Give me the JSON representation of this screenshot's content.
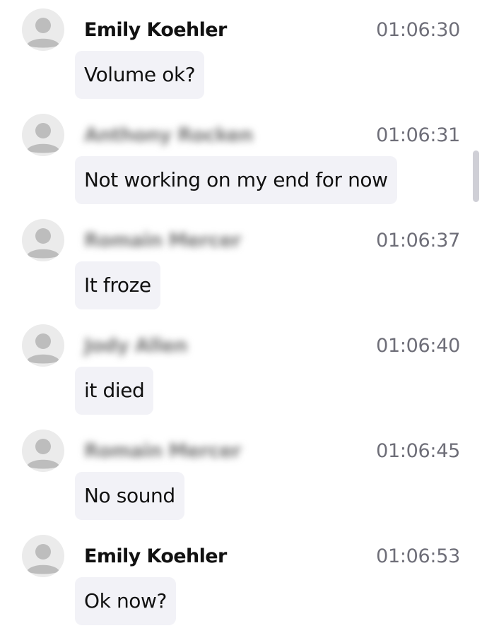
{
  "messages": [
    {
      "sender": "Emily Koehler",
      "time": "01:06:30",
      "text": "Volume ok?",
      "sender_blurred": false
    },
    {
      "sender": "Anthony Rocken",
      "time": "01:06:31",
      "text": "Not working on my end for now",
      "sender_blurred": true
    },
    {
      "sender": "Romain Mercer",
      "time": "01:06:37",
      "text": "It froze",
      "sender_blurred": true
    },
    {
      "sender": "Jody Allen",
      "time": "01:06:40",
      "text": "it died",
      "sender_blurred": true
    },
    {
      "sender": "Romain Mercer",
      "time": "01:06:45",
      "text": "No sound",
      "sender_blurred": true
    },
    {
      "sender": "Emily Koehler",
      "time": "01:06:53",
      "text": "Ok now?",
      "sender_blurred": false
    }
  ],
  "icons": {
    "avatar": "user-silhouette-icon"
  },
  "colors": {
    "bubble": "#f2f2f7",
    "timestamp": "#6e6e78",
    "avatar_bg": "#ebebeb",
    "avatar_fg": "#bdbdbd"
  }
}
